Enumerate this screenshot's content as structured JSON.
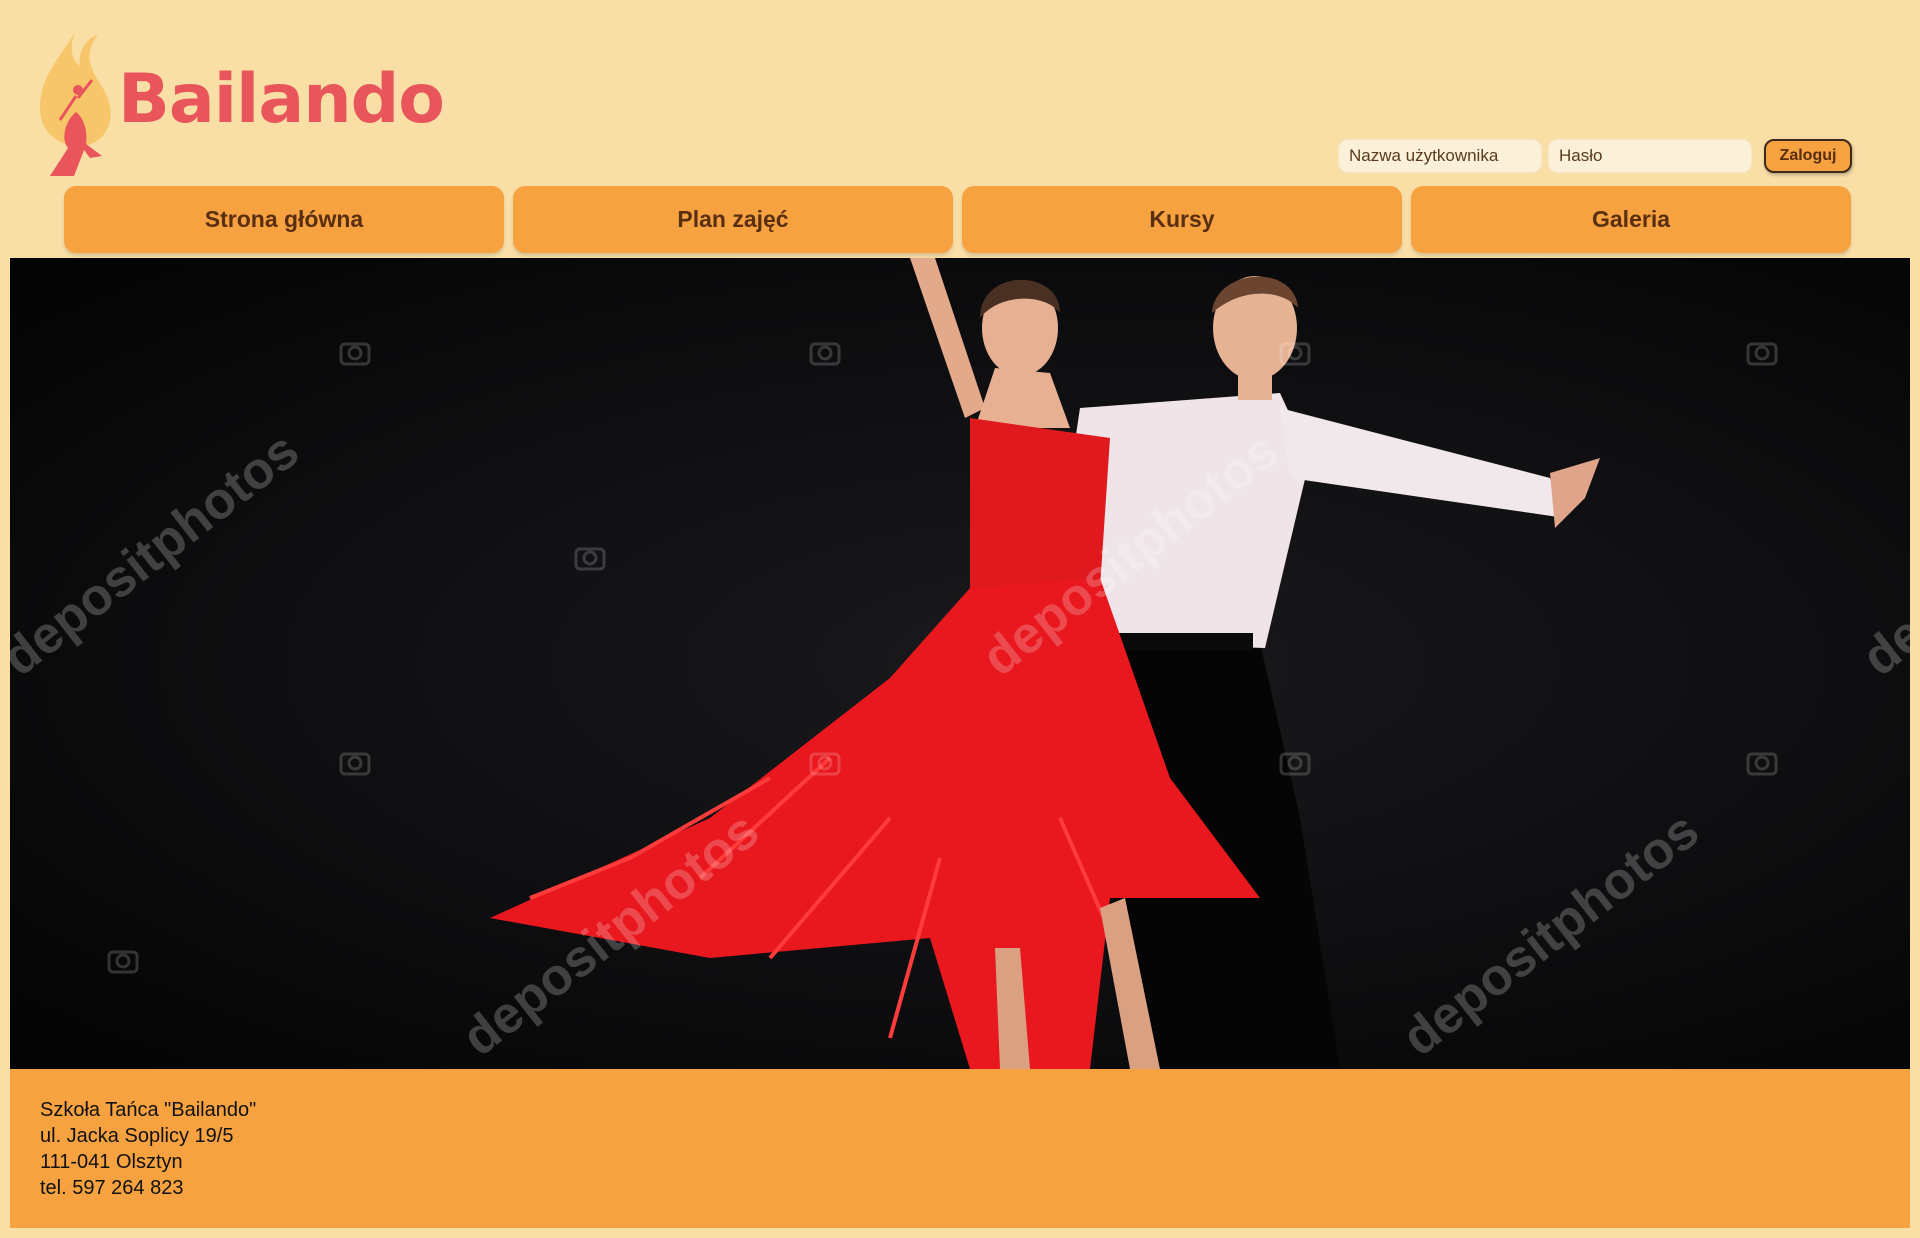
{
  "brand": {
    "name": "Bailando"
  },
  "login": {
    "username_placeholder": "Nazwa użytkownika",
    "password_placeholder": "Hasło",
    "submit_label": "Zaloguj"
  },
  "nav": [
    {
      "label": "Strona główna"
    },
    {
      "label": "Plan zajęć"
    },
    {
      "label": "Kursy"
    },
    {
      "label": "Galeria"
    }
  ],
  "hero": {
    "watermark": "depositphotos",
    "icon": "camera-icon"
  },
  "footer": {
    "school_name": "Szkoła Tańca \"Bailando\"",
    "address_street": "ul. Jacka Soplicy 19/5",
    "address_city": "111-041 Olsztyn",
    "phone": "tel. 597 264 823"
  },
  "colors": {
    "background": "#f9dea6",
    "accent": "#f7a240",
    "brand": "#e8555a",
    "nav_text": "#5a2e10"
  }
}
